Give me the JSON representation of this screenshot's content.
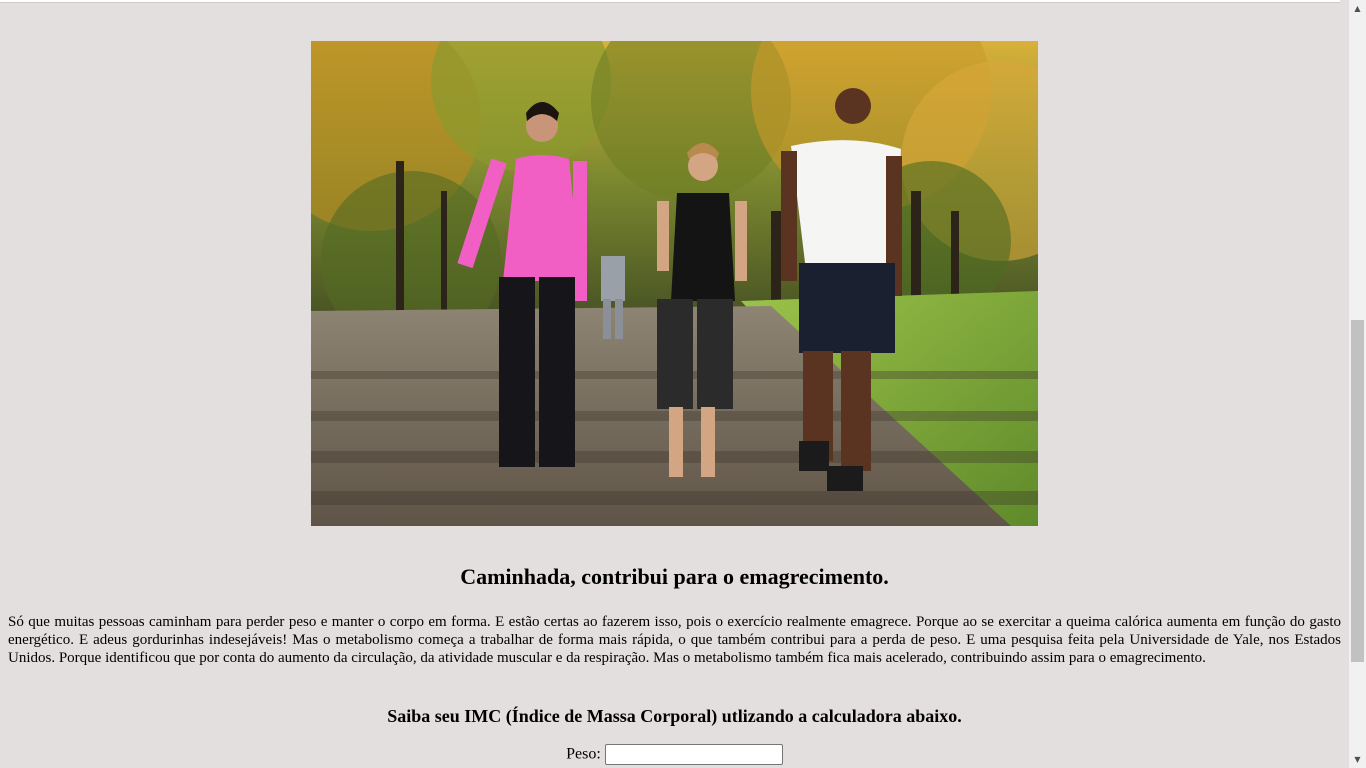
{
  "hero_image": {
    "alt": "walking-people-photo"
  },
  "article": {
    "title": "Caminhada, contribui para o emagrecimento.",
    "body": "Só que muitas pessoas caminham para perder peso e manter o corpo em forma. E estão certas ao fazerem isso, pois o exercício realmente emagrece. Porque ao se exercitar a queima calórica aumenta em função do gasto energético. E adeus gordurinhas indesejáveis! Mas o metabolismo começa a trabalhar de forma mais rápida, o que também contribui para a perda de peso. E uma pesquisa feita pela Universidade de Yale, nos Estados Unidos. Porque identificou que por conta do aumento da circulação, da atividade muscular e da respiração. Mas o metabolismo também fica mais acelerado, contribuindo assim para o emagrecimento."
  },
  "imc": {
    "heading": "Saiba seu IMC (Índice de Massa Corporal) utlizando a calculadora abaixo.",
    "peso_label": "Peso:",
    "peso_value": ""
  },
  "scrollbar": {
    "up_icon": "triangle-up",
    "down_icon": "triangle-down"
  },
  "colors": {
    "page_background": "#e4dfdf",
    "scrollbar_track": "#f1f1f1",
    "scrollbar_thumb": "#c1c1c1"
  }
}
